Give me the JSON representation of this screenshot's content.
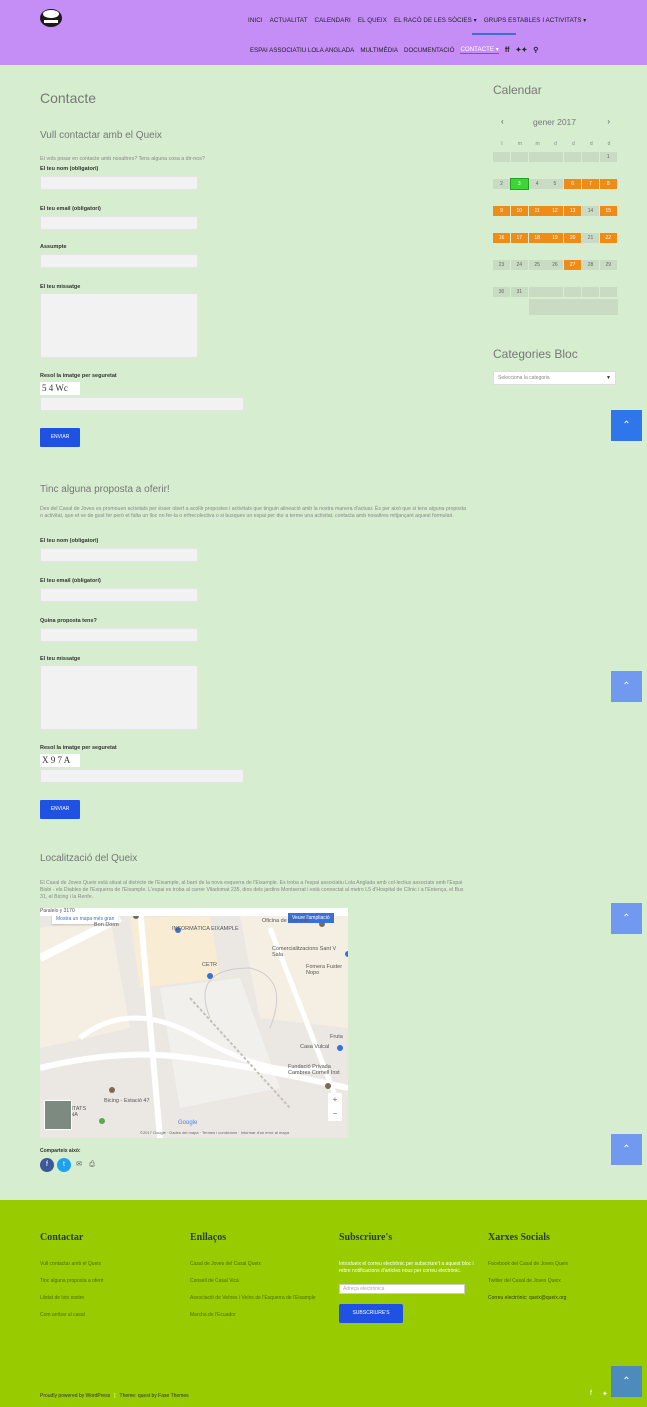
{
  "header": {
    "nav_row1": [
      "INICI",
      "ACTUALITAT",
      "CALENDARI",
      "EL QUEIX",
      "EL RACÓ DE LES SÒCIES ▾",
      "GRUPS ESTABLES I ACTIVITATS ▾"
    ],
    "nav_row2": [
      "ESPAI ASSOCIATIU LOLA ANGLADA",
      "MULTIMÈDIA",
      "DOCUMENTACIÓ",
      "CONTACTE ▾"
    ],
    "icon_ff": "ff",
    "icon_twitter": "✦✦",
    "icon_search": "⚲"
  },
  "main": {
    "title": "Contacte",
    "section1": {
      "title": "Vull contactar amb el Queix",
      "intro": "Et vols posar en contacte amb nosaltres? Tens alguna cosa a dir-nos?",
      "field_name": "El teu nom (obligatori)",
      "field_email": "El teu email (obligatori)",
      "field_subject": "Assumpte",
      "field_message": "El teu missatge",
      "field_captcha": "Resol la imatge per seguretat",
      "captcha_text": "5 4 Wc",
      "submit": "Enviar"
    },
    "section2": {
      "title": "Tinc alguna proposta a oferir!",
      "intro": "Des del Casal de Joves es promouen activitats per ésser obert a acollir propostes i activitats que tinguin alineació amb la nostra manera d'actuar. És per això que si tens alguna proposta o activitat, que et ve de gust fer però et falta un lloc on fer-la o erfrecolectiva o si busques un espai per dur a terme una activitat, contacta amb nosaltres mitjançant aquest formulari.",
      "field_name": "El teu nom (obligatori)",
      "field_email": "El teu email (obligatori)",
      "field_proposal": "Quina proposta tens?",
      "field_message": "El teu missatge",
      "field_captcha": "Resol la imatge per seguretat",
      "captcha_text": "X 9 7 A",
      "submit": "Enviar"
    },
    "section3": {
      "title": "Localització del Queix",
      "intro": "El Casal de Joves Queix està situat al districte de l'Eixample, al barri de la nova esquerra de l'Eixample. Es troba a l'espai associatiu Lola Anglada amb col·lectius associats amb l'Espai Bisbi - els Diables de l'Esquerra de l'Eixample. L'espai es troba al carrer Viladomat 235, dins dels jardins Montserrat i està connectat al metro L5 d'Hospital de Clínic i a l'Entença, el Bus 31, el Bicing i la Renfe."
    },
    "map": {
      "open_btn": "Mostra un mapa més gran",
      "save_btn": "Veure l'ampliació",
      "labels": [
        "Paralelo y 3170",
        "Bon Dorm",
        "INFORMÀTICA EIXAMPLE",
        "Oficina de Correus",
        "CETR",
        "Comercialitzacions Sant V Sala",
        "Fomera Fuster Nopo",
        "Fruta",
        "Casa Vulcal",
        "Fundació Privada Cambres Cornell Inst",
        "Bicing - Estació 47",
        "OPORTUNITATS BARCELONA"
      ],
      "google": "Google",
      "footer_text": "©2017 Google · Dades del mapa · Termes i condicions · Informar d'un error al mapa"
    },
    "share": {
      "label": "Comparteix això:"
    }
  },
  "sidebar": {
    "calendar_title": "Calendar",
    "prev": "‹",
    "next": "›",
    "month": "gener 2017",
    "weekdays": [
      "l",
      "m",
      "m",
      "d",
      "d",
      "d",
      "d"
    ],
    "rows": [
      [
        "",
        "",
        "",
        "",
        "",
        "",
        "1"
      ],
      [
        "2",
        "3",
        "4",
        "5",
        "6",
        "7",
        "8"
      ],
      [
        "9",
        "10",
        "11",
        "12",
        "13",
        "14",
        "15"
      ],
      [
        "16",
        "17",
        "18",
        "19",
        "20",
        "21",
        "22"
      ],
      [
        "23",
        "24",
        "25",
        "26",
        "27",
        "28",
        "29"
      ],
      [
        "30",
        "31",
        "",
        "",
        "",
        "",
        ""
      ]
    ],
    "categories_title": "Categories Bloc",
    "categories_select": "Selecciona la categoria"
  },
  "scrolltop": "⌃",
  "footer": {
    "col1_title": "Contactar",
    "col1_links": [
      "Vull contactar amb el Queix",
      "Tinc alguna proposta a oferir",
      "Llistat de lots sostre",
      "Com arribar al casal"
    ],
    "col2_title": "Enllaços",
    "col2_links": [
      "Casal de Joves del Casal Queix",
      "Consell de Casal Vicà",
      "Associació de Veïnes i Veïns de l'Esquerra de l'Eixample",
      "Marcha de l'Ecuador"
    ],
    "col3_title": "Subscriure's",
    "col3_text": "Introdueix el correu electrònic per subscriure't a aquest bloc i rebre notificacions d'articles nous per correu electrònic.",
    "col3_placeholder": "Adreça electrònica",
    "col3_button": "SUBSCRIURE'S",
    "col4_title": "Xarxes Socials",
    "col4_links": [
      "Facebook del Casal de Joves Queix",
      "Twitter del Casal de Joves Queix",
      "Correu electrònic: queix@queix.org"
    ],
    "powered": "Proudly powered by WordPress",
    "theme": "Theme: quest by Fase Themes",
    "social_f": "f",
    "social_t": "✦"
  },
  "colors": {
    "header_bg": "#c58df6",
    "body_bg": "#d6edcf",
    "footer_bg": "#98cc00",
    "accent_blue": "#1f52e3",
    "calendar_orange": "#ef8c18",
    "calendar_today": "#3dd633"
  }
}
